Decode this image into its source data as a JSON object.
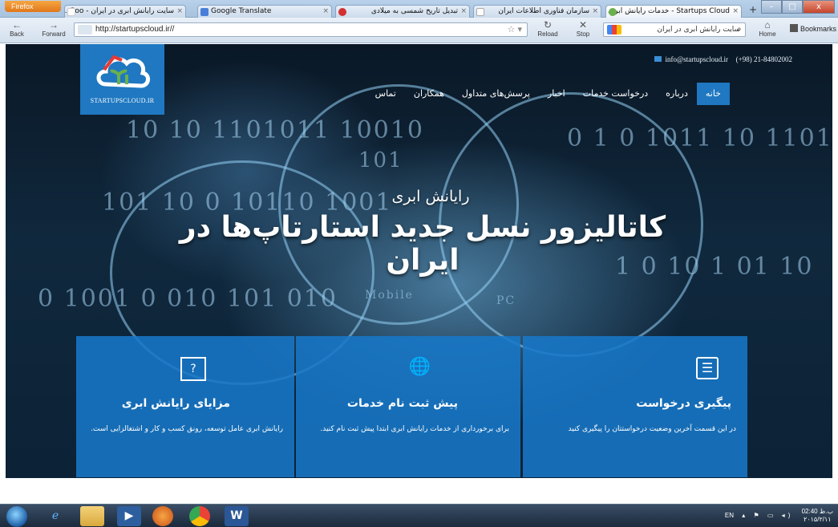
{
  "browser": {
    "firefox_button": "Firefox",
    "tabs": [
      {
        "label": "سایت رایانش ابری در ایران - Goo...",
        "active": false,
        "icon_color": "#e8eaed"
      },
      {
        "label": "Google Translate",
        "active": false,
        "icon_color": "#4a7fd9"
      },
      {
        "label": "تبدیل تاریخ شمسی به میلادی",
        "active": false,
        "icon_color": "#d32f2f"
      },
      {
        "label": "سازمان فناوری اطلاعات ایران",
        "active": false,
        "icon_color": "#ffffff"
      },
      {
        "label": "Startups Cloud - خدمات رایانش ابر...",
        "active": true,
        "icon_color": "#6ab04c"
      }
    ],
    "new_tab": "+",
    "window_controls": [
      "–",
      "□",
      "x"
    ],
    "back_label": "Back",
    "forward_label": "Forward",
    "url": "http://startupscloud.ir//",
    "reload_label": "Reload",
    "stop_label": "Stop",
    "search_text": "سایت رایانش ابری در ایران",
    "home_label": "Home",
    "bookmarks_label": "Bookmarks"
  },
  "site": {
    "logo_text": "STARTUPSCLOUD.IR",
    "email": "info@startupscloud.ir",
    "phone": "(+98) 21-84802002",
    "nav": [
      {
        "label": "خانه",
        "active": true
      },
      {
        "label": "درباره",
        "active": false
      },
      {
        "label": "درخواست خدمات",
        "active": false
      },
      {
        "label": "اخبار",
        "active": false
      },
      {
        "label": "پرسش‌های متداول",
        "active": false
      },
      {
        "label": "همکاران",
        "active": false
      },
      {
        "label": "تماس",
        "active": false
      }
    ],
    "hero_subtitle": "رایانش ابری",
    "hero_title": "کاتالیزور نسل جدید استارتاپ‌ها در ایران",
    "hero_bg_texts": {
      "mobile": "Mobile",
      "pc": "PC",
      "bits": "101"
    },
    "cards": [
      {
        "icon": "question-bubble-icon",
        "glyph": "?",
        "title": "مزایای رایانش ابری",
        "desc": "رایانش ابری عامل توسعه، رونق کسب و کار و اشتغالزایی است."
      },
      {
        "icon": "globe-icon",
        "glyph": "🌐",
        "title": "پیش ثبت نام خدمات",
        "desc": "برای برخورداری از خدمات رایانش ابری ابتدا پیش ثبت نام کنید."
      },
      {
        "icon": "list-icon",
        "glyph": "☰",
        "title": "پیگیری درخواست",
        "desc": "در این قسمت آخرین وضعیت درخواستتان را پیگیری کنید"
      }
    ]
  },
  "taskbar": {
    "apps": [
      "ie",
      "explorer",
      "media",
      "firefox",
      "chrome",
      "word"
    ],
    "language": "EN",
    "time": "02:40 ب.ظ",
    "date": "۲۰۱۵/۲/۱۱"
  }
}
